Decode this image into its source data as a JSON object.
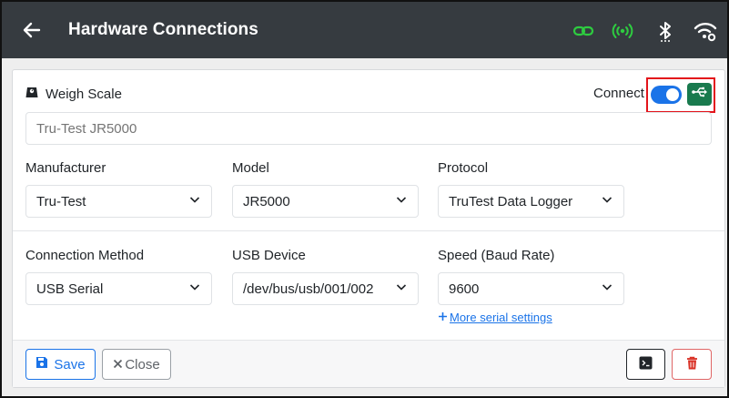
{
  "header": {
    "title": "Hardware Connections",
    "icons": [
      "back-arrow-icon",
      "link-icon",
      "broadcast-icon",
      "bluetooth-icon",
      "wifi-settings-icon"
    ],
    "status_color": "#2ecc40",
    "background": "#363b40"
  },
  "device": {
    "title": "Weigh Scale",
    "icon": "weigh-scale-icon",
    "connect_label": "Connect",
    "connected": true,
    "name_placeholder": "Tru-Test JR5000"
  },
  "fields": {
    "manufacturer": {
      "label": "Manufacturer",
      "value": "Tru-Test"
    },
    "model": {
      "label": "Model",
      "value": "JR5000"
    },
    "protocol": {
      "label": "Protocol",
      "value": "TruTest Data Logger"
    },
    "connection_method": {
      "label": "Connection Method",
      "value": "USB Serial"
    },
    "usb_device": {
      "label": "USB Device",
      "value": "/dev/bus/usb/001/002"
    },
    "speed": {
      "label": "Speed (Baud Rate)",
      "value": "9600"
    }
  },
  "more_settings_label": "More serial settings",
  "footer": {
    "save_label": "Save",
    "close_label": "Close"
  },
  "colors": {
    "accent": "#1a73e8",
    "usb_button": "#197a4e",
    "danger": "#d93025",
    "highlight": "#e3141b"
  }
}
